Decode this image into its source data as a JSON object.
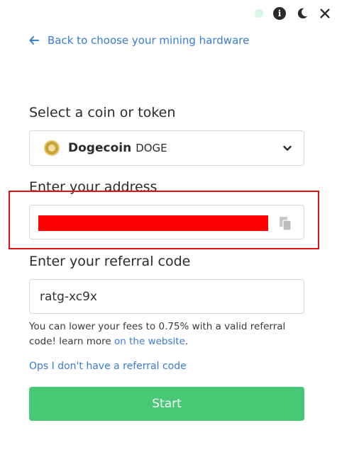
{
  "topbar": {
    "icons": [
      "status-dot",
      "info-icon",
      "moon-icon",
      "close-icon"
    ],
    "info_glyph": "i"
  },
  "back_link": {
    "label": "Back to choose your mining hardware"
  },
  "coin_section": {
    "label": "Select a coin or token",
    "selected_coin_name": "Dogecoin",
    "selected_coin_ticker": "DOGE"
  },
  "address_section": {
    "label": "Enter your address",
    "value": ""
  },
  "referral_section": {
    "label": "Enter your referral code",
    "value": "ratg-xc9x",
    "help_text_before": "You can lower your fees to 0.75% with a valid referral code! learn more ",
    "help_link": "on the website",
    "help_text_after": ".",
    "no_referral_link": "Ops I don't have a referral code"
  },
  "start_button": {
    "label": "Start"
  },
  "colors": {
    "accent_link": "#3a7bd5",
    "start_button": "#48c774",
    "highlight": "#dd1111",
    "redaction": "#ff0000"
  }
}
